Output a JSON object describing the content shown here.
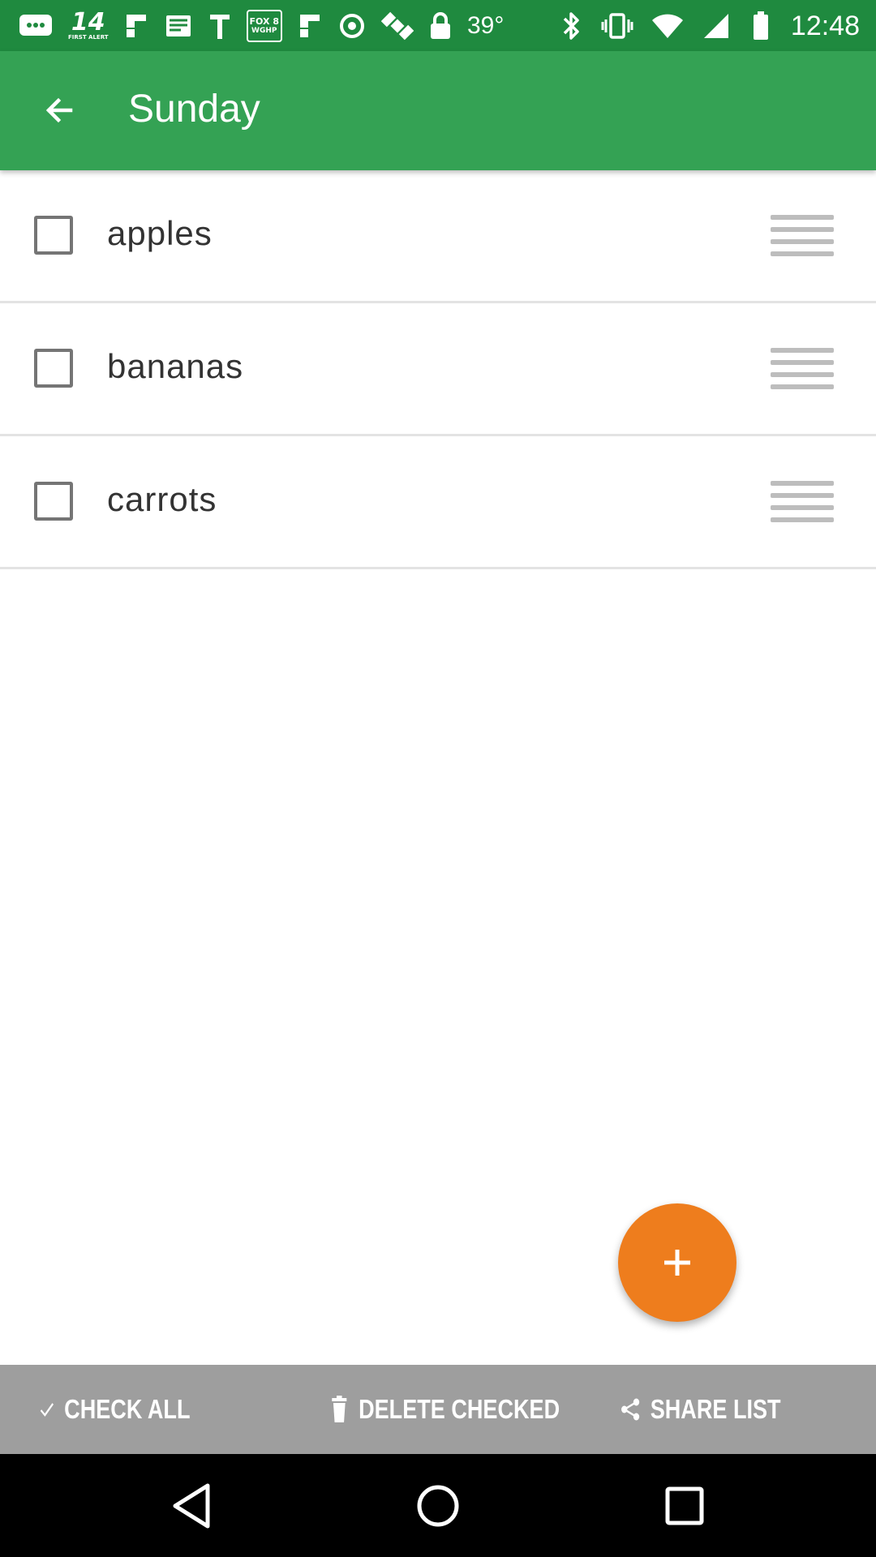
{
  "status_bar": {
    "channel_1": "14",
    "channel_1_sub": "FIRST ALERT",
    "channel_2": "FOX 8",
    "channel_2_sub": "WGHP",
    "temperature": "39°",
    "time": "12:48"
  },
  "app_bar": {
    "title": "Sunday"
  },
  "list": {
    "items": [
      {
        "label": "apples"
      },
      {
        "label": "bananas"
      },
      {
        "label": "carrots"
      }
    ]
  },
  "actions": {
    "check_all": "CHECK ALL",
    "delete_checked": "DELETE CHECKED",
    "share_list": "SHARE LIST"
  },
  "colors": {
    "status_bar": "#1f8a3f",
    "app_bar": "#34a254",
    "fab": "#ee7d1d",
    "action_bar": "#9e9e9e"
  },
  "icons": {
    "back": "arrow-back-icon",
    "drag": "drag-handle-icon",
    "add": "plus-icon",
    "check": "check-icon",
    "delete": "trash-icon",
    "share": "share-icon"
  }
}
